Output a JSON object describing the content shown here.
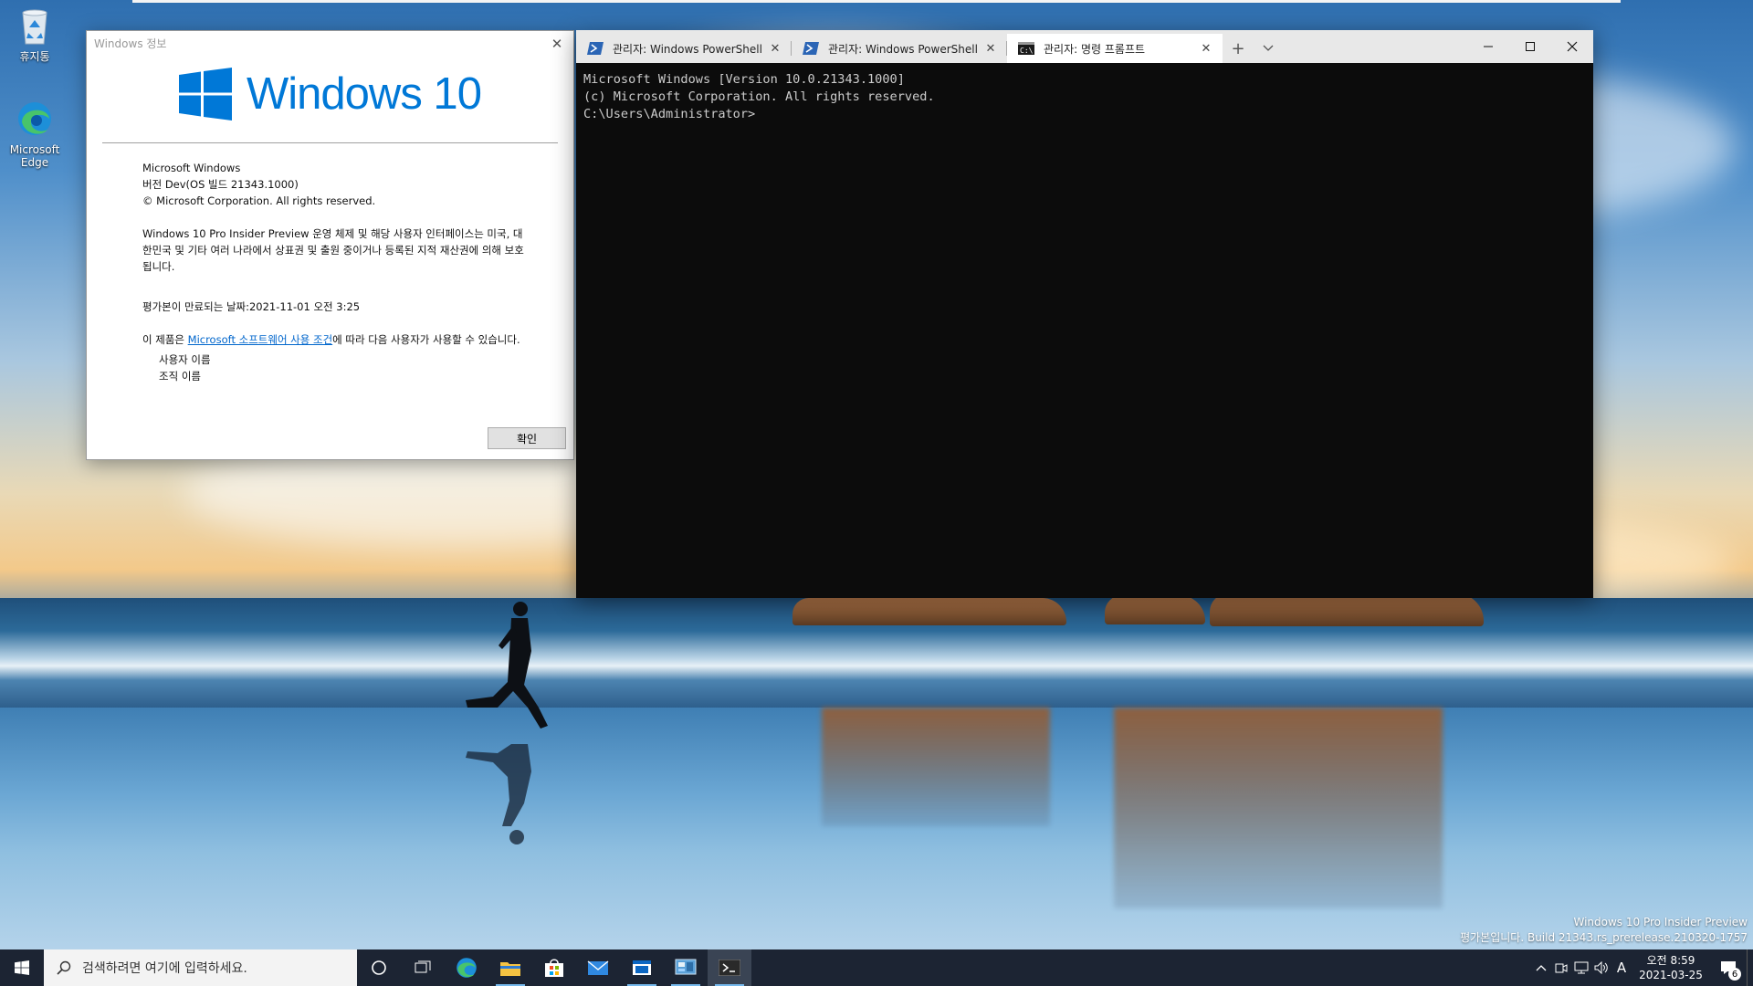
{
  "desktop": {
    "icons": [
      {
        "label": "휴지통",
        "icon": "recycle-bin-icon"
      },
      {
        "label": "Microsoft Edge",
        "icon": "edge-icon"
      }
    ],
    "watermark": {
      "line1": "Windows 10 Pro Insider Preview",
      "line2": "평가본입니다. Build 21343.rs_prerelease.210320-1757"
    }
  },
  "winver": {
    "title": "Windows 정보",
    "logo_text": "Windows 10",
    "product": "Microsoft Windows",
    "version": "버전 Dev(OS 빌드 21343.1000)",
    "copyright": "© Microsoft Corporation. All rights reserved.",
    "legal": "Windows 10 Pro Insider Preview 운영 체제 및 해당 사용자 인터페이스는 미국, 대한민국 및 기타 여러 나라에서 상표권 및 출원 중이거나 등록된 지적 재산권에 의해 보호됩니다.",
    "expiry": "평가본이 만료되는 날짜:2021-11-01 오전 3:25",
    "license_prefix": "이 제품은 ",
    "license_link": "Microsoft 소프트웨어 사용 조건",
    "license_suffix": "에 따라 다음 사용자가 사용할 수 있습니다.",
    "user_name": "사용자 이름",
    "org_name": "조직 이름",
    "ok_label": "확인"
  },
  "terminal": {
    "tabs": [
      {
        "label": "관리자: Windows PowerShell",
        "icon": "powershell-icon",
        "active": false
      },
      {
        "label": "관리자: Windows PowerShell",
        "icon": "powershell-icon",
        "active": false
      },
      {
        "label": "관리자: 명령 프롬프트",
        "icon": "cmd-icon",
        "active": true
      }
    ],
    "lines": [
      "Microsoft Windows [Version 10.0.21343.1000]",
      "(c) Microsoft Corporation. All rights reserved.",
      "",
      "C:\\Users\\Administrator>"
    ]
  },
  "taskbar": {
    "search_placeholder": "검색하려면 여기에 입력하세요.",
    "pinned": [
      {
        "name": "cortana-icon",
        "running": false
      },
      {
        "name": "task-view-icon",
        "running": false
      },
      {
        "name": "edge-icon",
        "running": false
      },
      {
        "name": "file-explorer-icon",
        "running": true
      },
      {
        "name": "store-icon",
        "running": false
      },
      {
        "name": "mail-icon",
        "running": false
      },
      {
        "name": "app-window-icon",
        "running": true
      },
      {
        "name": "control-panel-icon",
        "running": true
      },
      {
        "name": "terminal-icon",
        "running": true,
        "active": true
      }
    ],
    "ime": "A",
    "time": "오전 8:59",
    "date": "2021-03-25",
    "notification_count": "6"
  }
}
